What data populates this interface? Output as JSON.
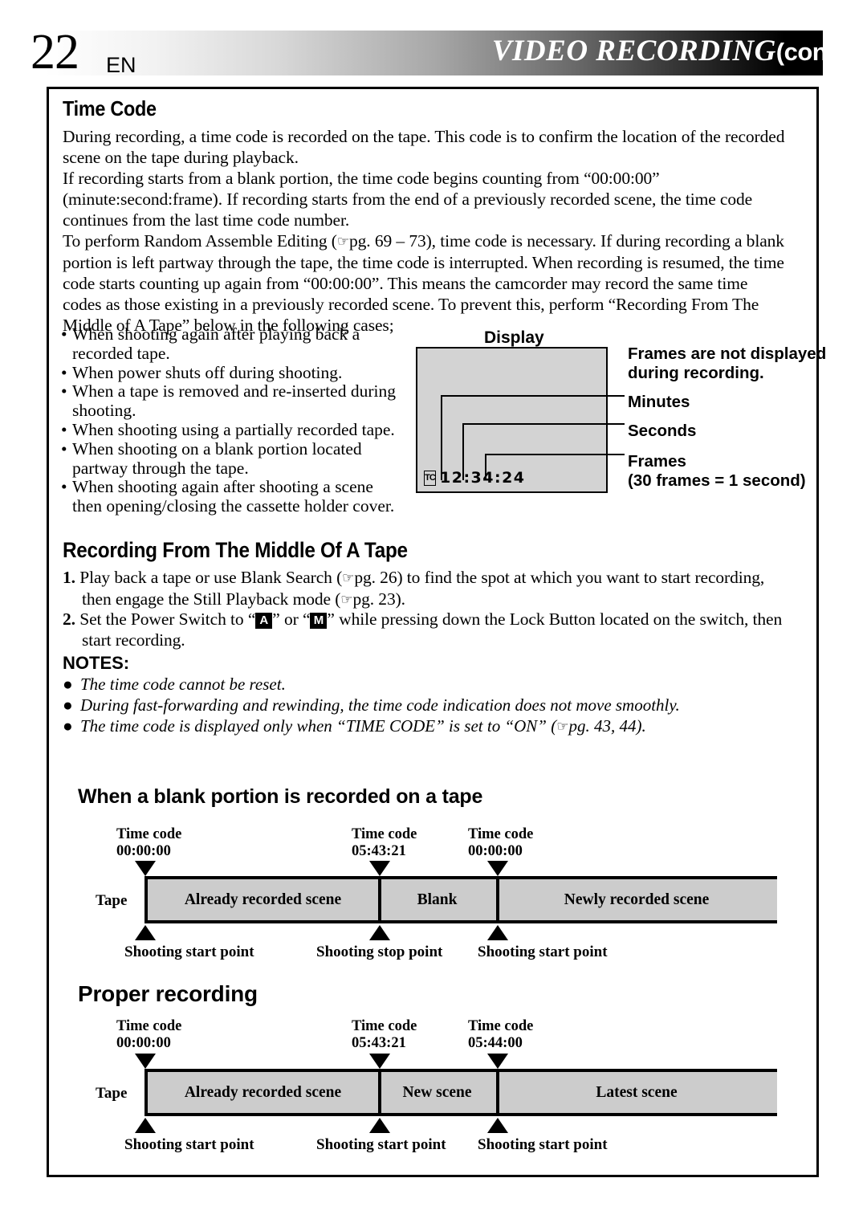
{
  "header": {
    "page_number": "22",
    "language": "EN",
    "title": "VIDEO RECORDING",
    "title_suffix": "(cont.)"
  },
  "time_code_section": {
    "heading": "Time Code",
    "para1_line1": "During recording, a time code is recorded on the tape. This code is to confirm the location of the recorded",
    "para1_line2": "scene on the tape during playback.",
    "para1_line3": "If recording starts from a blank portion, the time code begins counting from “00:00:00”",
    "para1_line4": "(minute:second:frame). If recording starts from the end of a previously recorded scene, the time code",
    "para1_line5": "continues from the last time code number.",
    "para2_line1_a": "To perform Random Assemble Editing (",
    "para2_line1_b": "pg. 69 – 73), time code is necessary. If during recording a blank",
    "para2_line2": "portion is left partway through the tape, the time code is interrupted. When recording is resumed, the time",
    "para2_line3": "code starts counting up again from “00:00:00”. This means the camcorder may record the same time",
    "para2_line4": "codes as those existing in a previously recorded scene. To prevent this, perform “Recording From The",
    "para2_line5": "Middle of A Tape” below in the following cases;",
    "bullets": [
      "When shooting again after playing back a recorded tape.",
      "When power shuts off during shooting.",
      "When a tape is removed and re-inserted during shooting.",
      "When shooting using a partially recorded tape.",
      "When shooting on a blank portion located partway through the tape.",
      "When shooting again after shooting a scene then opening/closing the cassette holder cover."
    ],
    "bullet_lines": [
      [
        "When shooting again after playing back a",
        "recorded tape."
      ],
      [
        "When power shuts off during shooting."
      ],
      [
        "When a tape is removed and re-inserted during",
        "shooting."
      ],
      [
        "When shooting using a partially recorded tape."
      ],
      [
        "When shooting on a blank portion located",
        "partway through the tape."
      ],
      [
        "When shooting again after shooting a scene",
        "then opening/closing the cassette holder cover."
      ]
    ]
  },
  "display_diagram": {
    "label": "Display",
    "tc_glyph": "TC",
    "time_code": "12:34:24",
    "notes": {
      "frames_note_line1": "Frames are not displayed",
      "frames_note_line2": "during recording.",
      "minutes": "Minutes",
      "seconds": "Seconds",
      "frames": "Frames",
      "frames_sub": "(30 frames = 1 second)"
    }
  },
  "recording_middle_section": {
    "heading": "Recording From The Middle Of A Tape",
    "step1_num": "1.",
    "step1_a": "Play back a tape or use Blank Search (",
    "step1_b": "pg. 26) to find the spot at which you want to start recording,",
    "step1_c": "then engage the Still Playback mode (",
    "step1_d": "pg. 23).",
    "step2_num": "2.",
    "step2_a": "Set the Power Switch to “",
    "step2_icon_a": "A",
    "step2_b": "” or “",
    "step2_icon_m": "M",
    "step2_c": "” while pressing down the Lock Button located on the switch, then",
    "step2_d": "start recording.",
    "notes_heading": "NOTES:",
    "notes": [
      "The time code cannot be reset.",
      "During fast-forwarding and rewinding, the time code indication does not move smoothly.",
      "The time code is displayed only when “TIME CODE” is set to “ON” (   pg. 43, 44)."
    ],
    "note3_a": "The time code is displayed only when “TIME CODE” is set to “ON” (",
    "note3_b": "pg. 43, 44)."
  },
  "diagram_blank": {
    "heading": "When a blank portion is recorded on a tape",
    "tape_label": "Tape",
    "timecode_caption": "Time code",
    "markers": [
      {
        "caption": "Time code",
        "value": "00:00:00",
        "point": "Shooting start point"
      },
      {
        "caption": "Time code",
        "value": "05:43:21",
        "point": "Shooting stop point"
      },
      {
        "caption": "Time code",
        "value": "00:00:00",
        "point": "Shooting start point"
      }
    ],
    "segments": [
      "Already recorded scene",
      "Blank",
      "Newly recorded scene"
    ]
  },
  "diagram_proper": {
    "heading": "Proper recording",
    "tape_label": "Tape",
    "timecode_caption": "Time code",
    "markers": [
      {
        "caption": "Time code",
        "value": "00:00:00",
        "point": "Shooting start point"
      },
      {
        "caption": "Time code",
        "value": "05:43:21",
        "point": "Shooting start point"
      },
      {
        "caption": "Time code",
        "value": "05:44:00",
        "point": "Shooting start point"
      }
    ],
    "segments": [
      "Already recorded scene",
      "New scene",
      "Latest scene"
    ]
  },
  "colors": {
    "tape_fill": "#cccccc",
    "display_fill": "#d3d3d3",
    "ink": "#000000"
  }
}
